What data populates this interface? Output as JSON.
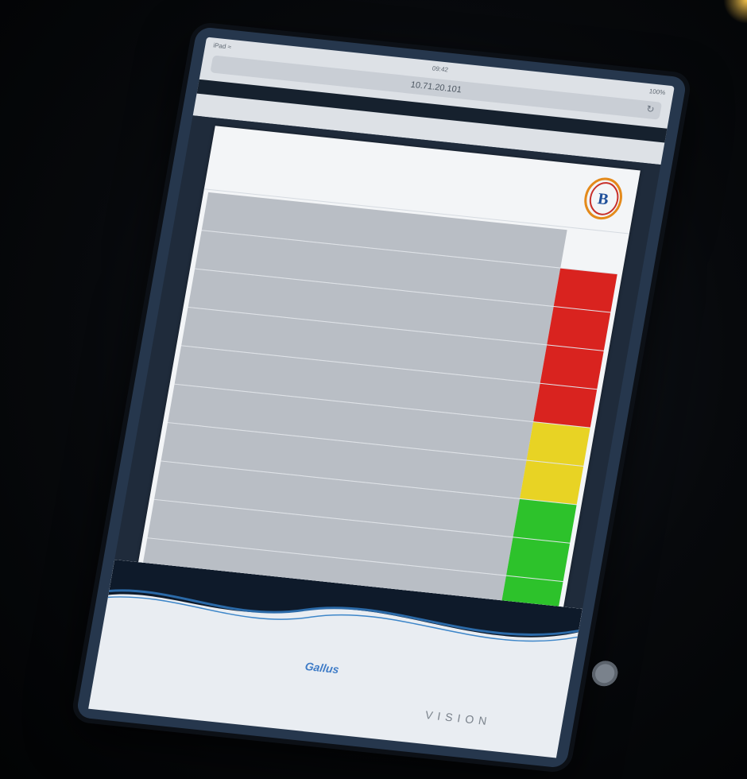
{
  "browser": {
    "status_left": "iPad ≈",
    "status_center": "09:42",
    "status_right": "100%",
    "url": "10.71.20.101",
    "tab_left": "",
    "tab_right": ""
  },
  "document": {
    "title": "",
    "logo_letter": "B"
  },
  "rows": [
    {
      "status": "none",
      "value": "",
      "count": ""
    },
    {
      "status": "red",
      "value": "",
      "count": ""
    },
    {
      "status": "red",
      "value": "",
      "count": ""
    },
    {
      "status": "red",
      "value": "",
      "count": ""
    },
    {
      "status": "red",
      "value": "",
      "count": ""
    },
    {
      "status": "yellow",
      "value": "",
      "count": ""
    },
    {
      "status": "yellow",
      "value": "",
      "count": ""
    },
    {
      "status": "green",
      "value": "",
      "count": ""
    },
    {
      "status": "green",
      "value": "",
      "count": ""
    },
    {
      "status": "green",
      "value": "",
      "count": ""
    },
    {
      "status": "green",
      "value": "",
      "count": ""
    }
  ],
  "colors": {
    "red": "#d9231f",
    "yellow": "#e8d324",
    "green": "#2dc22b",
    "tablet_frame": "#26374d"
  },
  "footer": {
    "brand": "Gallus",
    "sub": "",
    "powered": "",
    "vision": "VISION"
  }
}
